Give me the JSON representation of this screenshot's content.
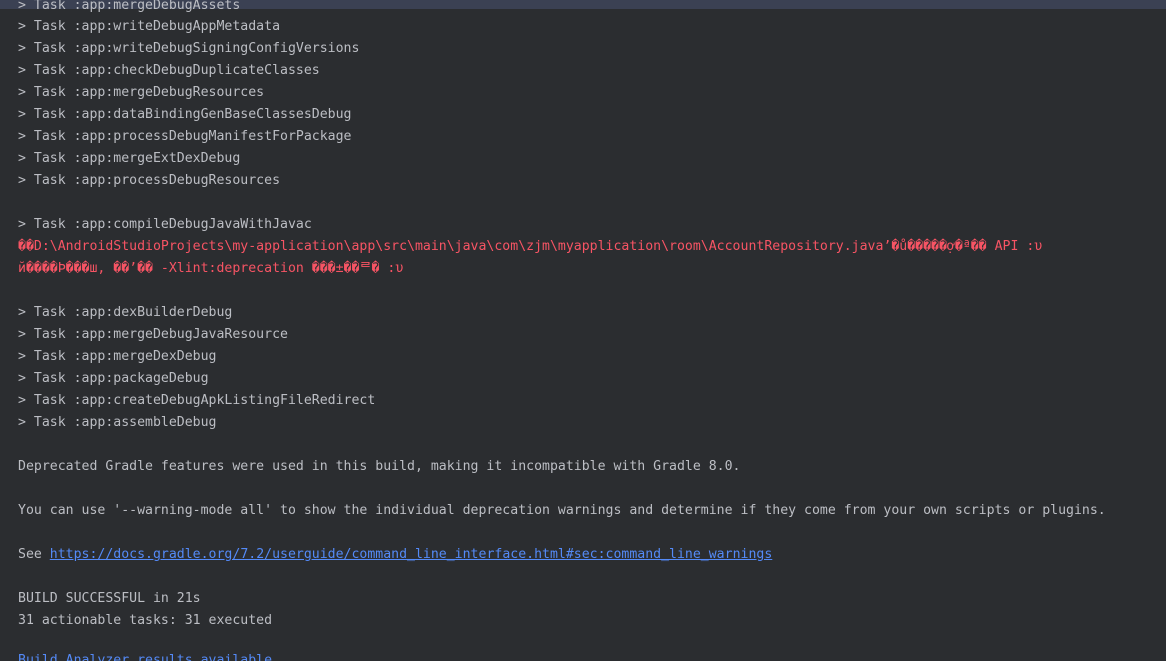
{
  "header_line": "> Task :app:mergeDebugAssets",
  "tasks_first": [
    "> Task :app:writeDebugAppMetadata",
    "> Task :app:writeDebugSigningConfigVersions",
    "> Task :app:checkDebugDuplicateClasses",
    "> Task :app:mergeDebugResources",
    "> Task :app:dataBindingGenBaseClassesDebug",
    "> Task :app:processDebugManifestForPackage",
    "> Task :app:mergeExtDexDebug",
    "> Task :app:processDebugResources"
  ],
  "compile_task": "> Task :app:compileDebugJavaWithJavac",
  "error_lines": [
    "��D:\\AndroidStudioProjects\\my-application\\app\\src\\main\\java\\com\\zjm\\myapplication\\room\\AccountRepository.java’�ů�����ợ�ª�� API :υ",
    "й����Þ���ш, ��’�� -Xlint:deprecation ���±��ᄅ� :υ"
  ],
  "tasks_second": [
    "> Task :app:dexBuilderDebug",
    "> Task :app:mergeDebugJavaResource",
    "> Task :app:mergeDexDebug",
    "> Task :app:packageDebug",
    "> Task :app:createDebugApkListingFileRedirect",
    "> Task :app:assembleDebug"
  ],
  "deprecated_msg": "Deprecated Gradle features were used in this build, making it incompatible with Gradle 8.0.",
  "warning_mode_msg": "You can use '--warning-mode all' to show the individual deprecation warnings and determine if they come from your own scripts or plugins.",
  "see_label": "See ",
  "docs_link": "https://docs.gradle.org/7.2/userguide/command_line_interface.html#sec:command_line_warnings",
  "build_result": "BUILD SUCCESSFUL in 21s",
  "tasks_summary": "31 actionable tasks: 31 executed",
  "partial_bottom": "Build Analyzer results available",
  "colors": {
    "background": "#2b2d30",
    "text": "#bcbec4",
    "error": "#f75464",
    "link": "#548af7"
  }
}
